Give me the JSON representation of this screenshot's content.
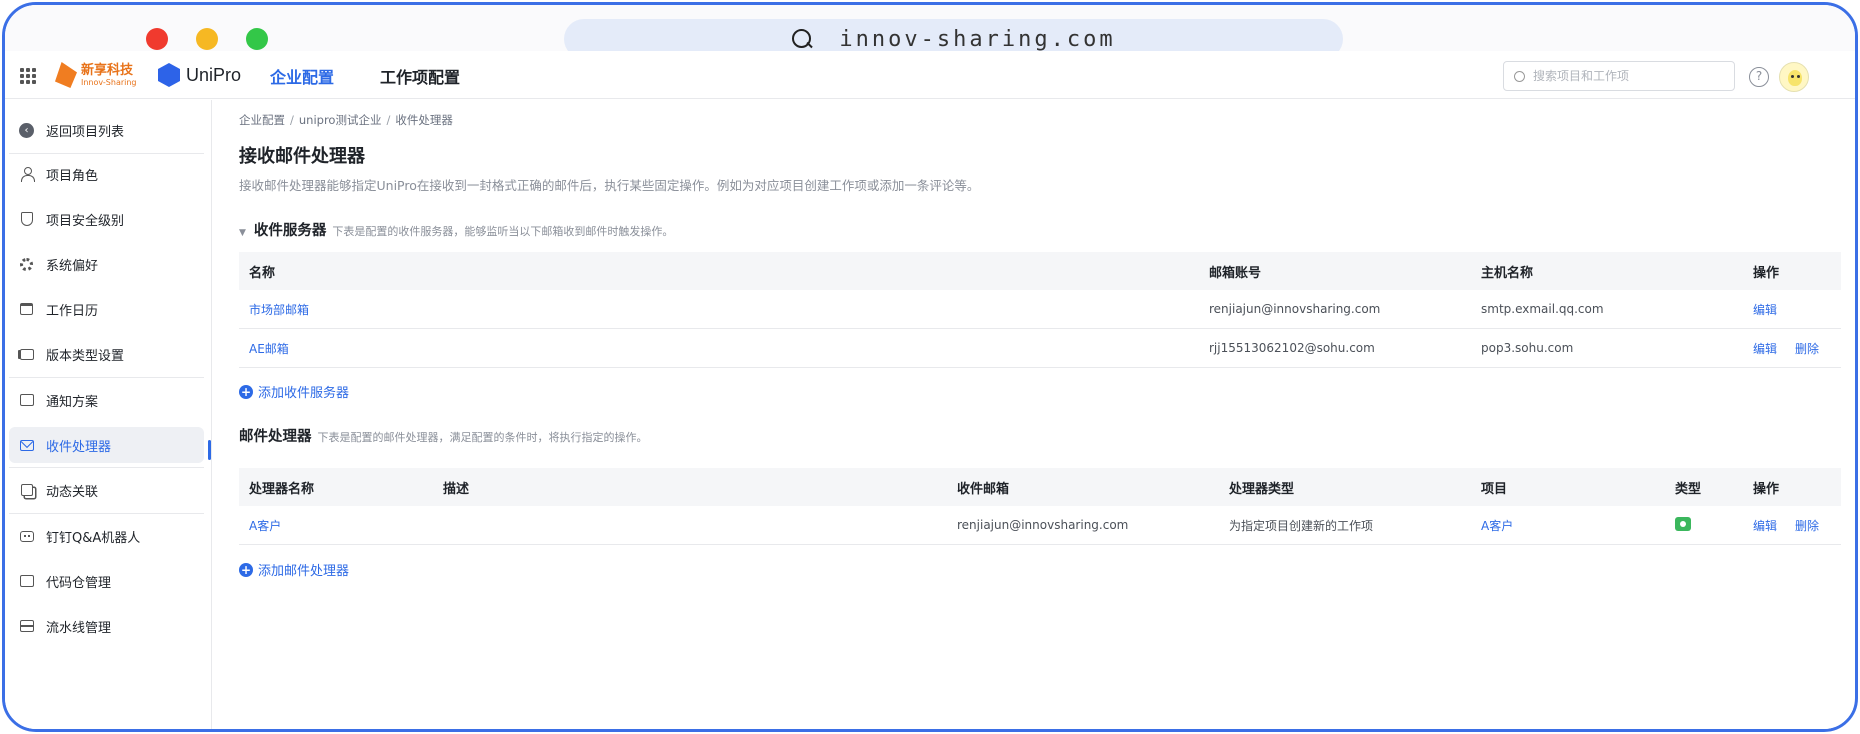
{
  "browser": {
    "url": "innov-sharing.com"
  },
  "header": {
    "brand_cn": "新享科技",
    "brand_en": "Innov-Sharing",
    "product": "UniPro",
    "tabs": [
      {
        "label": "企业配置",
        "active": true
      },
      {
        "label": "工作项配置",
        "active": false
      }
    ],
    "search_placeholder": "搜索项目和工作项",
    "help_glyph": "?"
  },
  "sidebar": {
    "items": [
      {
        "label": "返回项目列表",
        "icon": "back-icon",
        "active": false
      },
      {
        "label": "项目角色",
        "icon": "person-icon",
        "active": false
      },
      {
        "label": "项目安全级别",
        "icon": "shield-icon",
        "active": false
      },
      {
        "label": "系统偏好",
        "icon": "gear-icon",
        "active": false
      },
      {
        "label": "工作日历",
        "icon": "calendar-icon",
        "active": false
      },
      {
        "label": "版本类型设置",
        "icon": "stack-icon",
        "active": false
      },
      {
        "label": "通知方案",
        "icon": "message-icon",
        "active": false
      },
      {
        "label": "收件处理器",
        "icon": "mail-icon",
        "active": true
      },
      {
        "label": "动态关联",
        "icon": "copy-icon",
        "active": false
      },
      {
        "label": "钉钉Q&A机器人",
        "icon": "robot-icon",
        "active": false
      },
      {
        "label": "代码仓管理",
        "icon": "code-icon",
        "active": false
      },
      {
        "label": "流水线管理",
        "icon": "pipeline-icon",
        "active": false
      }
    ]
  },
  "main": {
    "breadcrumb": [
      "企业配置",
      "unipro测试企业",
      "收件处理器"
    ],
    "breadcrumb_sep": "/",
    "title": "接收邮件处理器",
    "description": "接收邮件处理器能够指定UniPro在接收到一封格式正确的邮件后，执行某些固定操作。例如为对应项目创建工作项或添加一条评论等。",
    "servers": {
      "title": "收件服务器",
      "desc": "下表是配置的收件服务器，能够监听当以下邮箱收到邮件时触发操作。",
      "columns": [
        "名称",
        "邮箱账号",
        "主机名称",
        "操作"
      ],
      "rows": [
        {
          "name": "市场部邮箱",
          "account": "renjiajun@innovsharing.com",
          "host": "smtp.exmail.qq.com",
          "ops": [
            "编辑"
          ]
        },
        {
          "name": "AE邮箱",
          "account": "rjj15513062102@sohu.com",
          "host": "pop3.sohu.com",
          "ops": [
            "编辑",
            "删除"
          ]
        }
      ],
      "add_label": "添加收件服务器"
    },
    "handlers": {
      "title": "邮件处理器",
      "desc": "下表是配置的邮件处理器，满足配置的条件时，将执行指定的操作。",
      "columns": [
        "处理器名称",
        "描述",
        "收件邮箱",
        "处理器类型",
        "项目",
        "类型",
        "操作"
      ],
      "rows": [
        {
          "name": "A客户",
          "desc": "",
          "mailbox": "renjiajun@innovsharing.com",
          "type": "为指定项目创建新的工作项",
          "project": "A客户",
          "kind_icon": "green-status-badge",
          "ops": [
            "编辑",
            "删除"
          ]
        }
      ],
      "add_label": "添加邮件处理器"
    }
  },
  "colors": {
    "accent": "#2d6ae6",
    "frame": "#3b6fe6",
    "traffic_red": "#f03a2e",
    "traffic_yellow": "#f6b823",
    "traffic_green": "#33c748",
    "status_green": "#3bb75d"
  }
}
